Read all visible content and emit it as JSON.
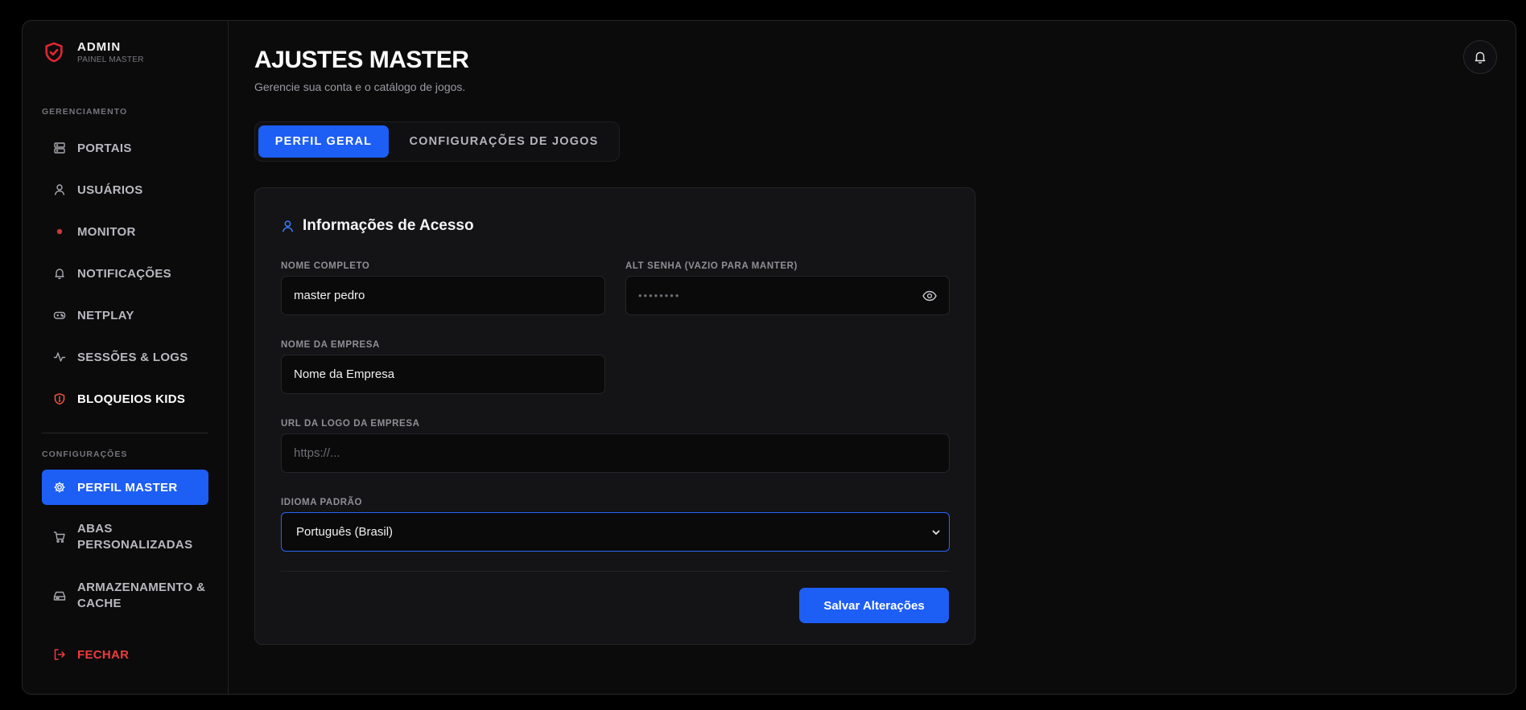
{
  "brand": {
    "title": "ADMIN",
    "subtitle": "PAINEL MASTER"
  },
  "sidebar": {
    "section_management": "GERENCIAMENTO",
    "section_settings": "CONFIGURAÇÕES",
    "items": [
      {
        "label": "PORTAIS",
        "icon": "server-icon"
      },
      {
        "label": "USUÁRIOS",
        "icon": "user-icon"
      },
      {
        "label": "MONITOR",
        "icon": "red-dot-icon"
      },
      {
        "label": "NOTIFICAÇÕES",
        "icon": "bell-icon"
      },
      {
        "label": "NETPLAY",
        "icon": "gamepad-icon"
      },
      {
        "label": "SESSÕES & LOGS",
        "icon": "activity-icon"
      },
      {
        "label": "BLOQUEIOS KIDS",
        "icon": "shield-icon"
      },
      {
        "label": "PERFIL MASTER",
        "icon": "gear-icon",
        "active": true
      },
      {
        "label": "ABAS PERSONALIZADAS",
        "icon": "cart-icon"
      },
      {
        "label": "ARMAZENAMENTO & CACHE",
        "icon": "hard-drive-icon"
      }
    ],
    "logout": "FECHAR"
  },
  "header": {
    "title": "AJUSTES MASTER",
    "subtitle": "Gerencie sua conta e o catálogo de jogos."
  },
  "tabs": [
    {
      "label": "PERFIL GERAL",
      "active": true
    },
    {
      "label": "CONFIGURAÇÕES DE JOGOS",
      "active": false
    }
  ],
  "form": {
    "title": "Informações de Acesso",
    "full_name": {
      "label": "NOME COMPLETO",
      "value": "master pedro"
    },
    "password": {
      "label": "ALT SENHA (VAZIO PARA MANTER)",
      "placeholder": "••••••••"
    },
    "company": {
      "label": "NOME DA EMPRESA",
      "value": "Nome da Empresa"
    },
    "logo_url": {
      "label": "URL DA LOGO DA EMPRESA",
      "placeholder": "https://..."
    },
    "language": {
      "label": "IDIOMA PADRÃO",
      "value": "Português (Brasil)"
    },
    "save_label": "Salvar Alterações"
  },
  "colors": {
    "accent": "#1d5ef5",
    "danger": "#ef3b3b",
    "kids": "#f0573a"
  }
}
